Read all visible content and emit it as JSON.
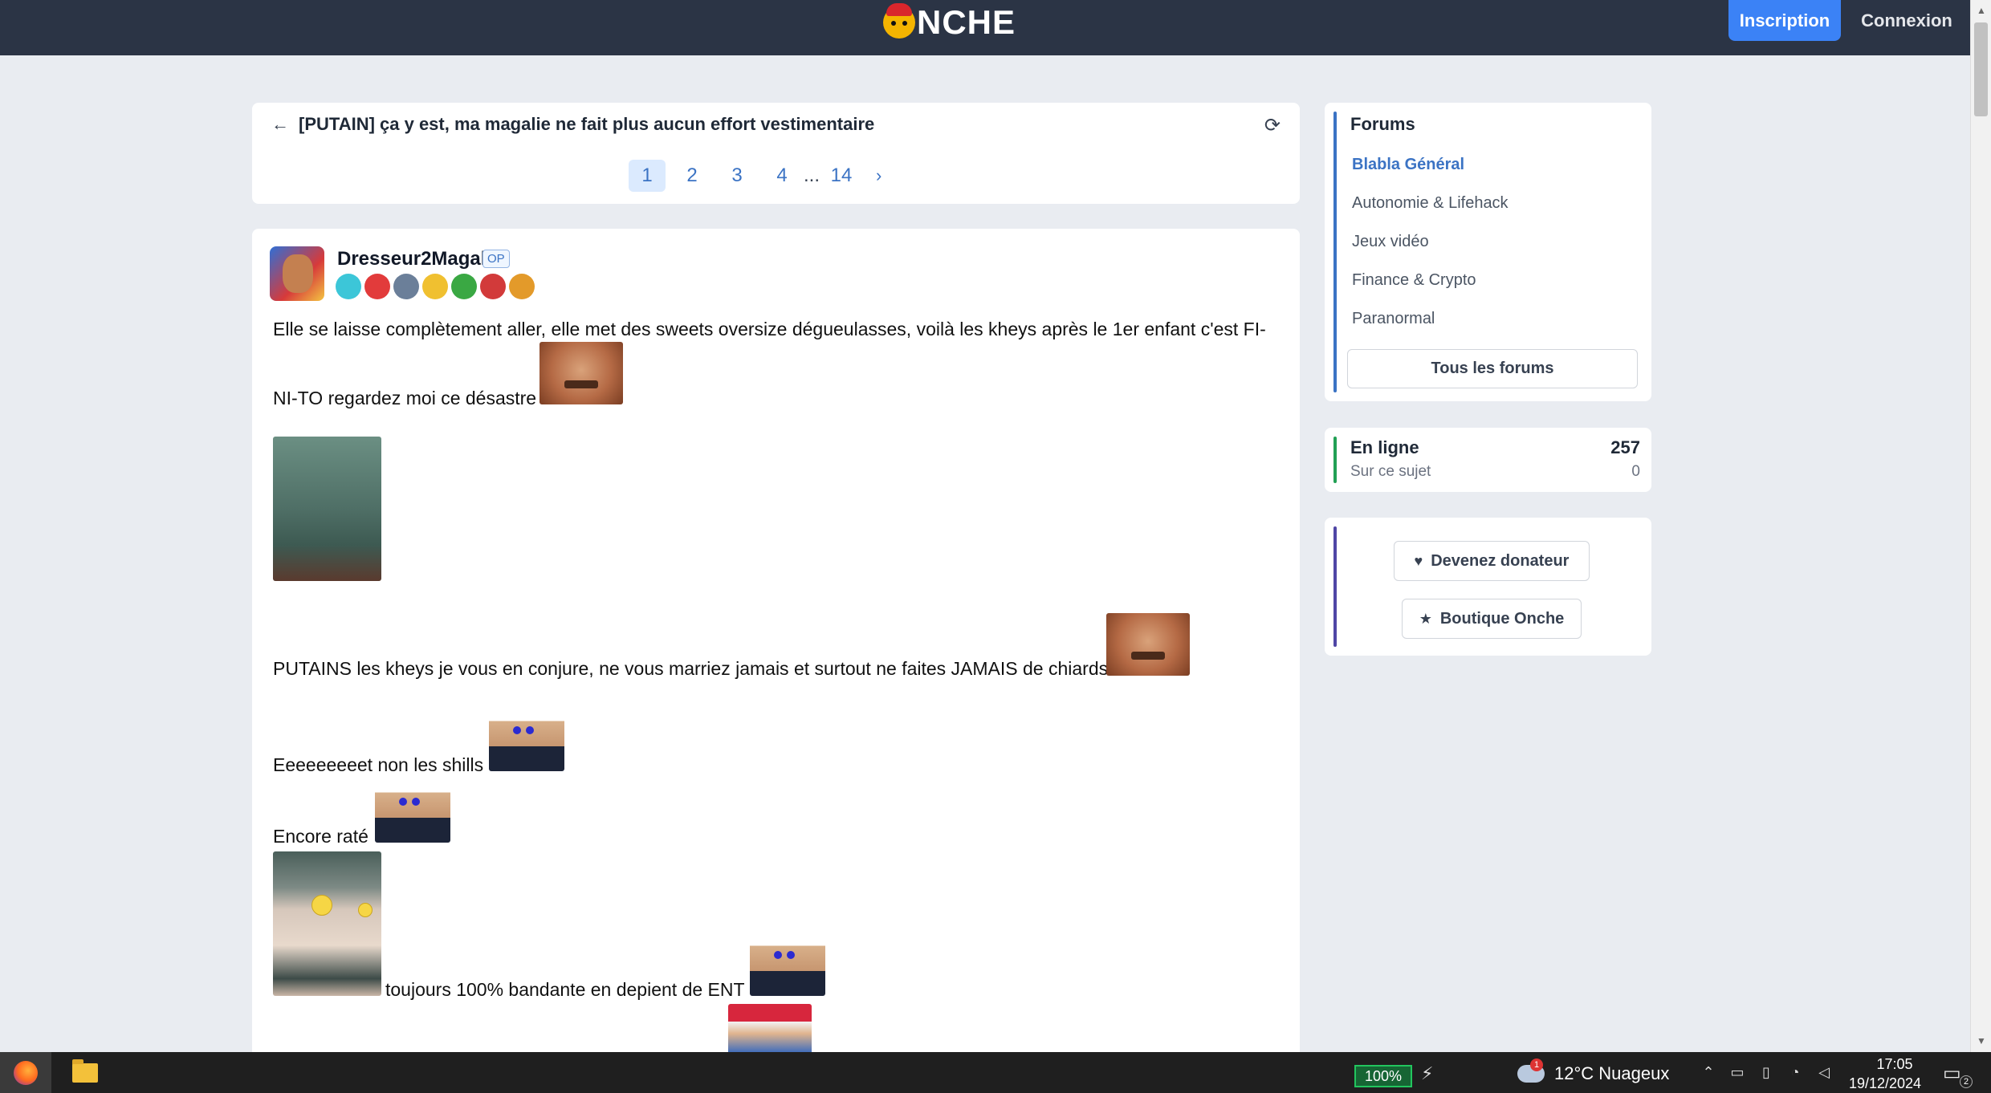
{
  "header": {
    "logo_text": "NCHE",
    "signup_label": "Inscription",
    "login_label": "Connexion",
    "background": "#2b3445",
    "accent": "#3b82f6"
  },
  "topic": {
    "back_icon": "arrow-left-icon",
    "title": "[PUTAIN] ça y est, ma magalie ne fait plus aucun effort vestimentaire",
    "refresh_icon": "refresh-icon",
    "pagination": {
      "pages": [
        "1",
        "2",
        "3",
        "4"
      ],
      "current": "1",
      "ellipsis": "...",
      "last": "14",
      "next_icon": "chevron-right-icon"
    }
  },
  "post": {
    "author": "Dresseur2Magali",
    "op_badge": "OP",
    "badge_colors": [
      "#3cc6d8",
      "#e23b3b",
      "#6b7f99",
      "#f0c030",
      "#3aa843",
      "#d23a3a",
      "#e39a2a"
    ],
    "lines": [
      "Elle se laisse complètement aller, elle met des sweets oversize dégueulasses, voilà les kheys après le 1er enfant c'est FI-",
      "NI-TO regardez moi ce désastre",
      "PUTAINS les kheys je vous en conjure, ne vous marriez jamais et surtout ne faites JAMAIS de chiards",
      "Eeeeeeeeet non les shills",
      "Encore raté",
      "toujours 100% bandante en depient de ENT"
    ]
  },
  "sidebar": {
    "forums": {
      "title": "Forums",
      "accent": "#3b73c4",
      "items": [
        {
          "label": "Blabla Général",
          "active": true
        },
        {
          "label": "Autonomie & Lifehack",
          "active": false
        },
        {
          "label": "Jeux vidéo",
          "active": false
        },
        {
          "label": "Finance & Crypto",
          "active": false
        },
        {
          "label": "Paranormal",
          "active": false
        }
      ],
      "all_label": "Tous les forums"
    },
    "online": {
      "accent": "#22a055",
      "label": "En ligne",
      "count": "257",
      "topic_label": "Sur ce sujet",
      "topic_count": "0"
    },
    "support": {
      "accent": "#4f46a5",
      "donate_label": "Devenez donateur",
      "donate_icon": "heart-icon",
      "shop_label": "Boutique Onche",
      "shop_icon": "star-icon"
    }
  },
  "taskbar": {
    "battery": "100%",
    "weather": "12°C  Nuageux",
    "weather_badge": "1",
    "time": "17:05",
    "date": "19/12/2024",
    "notifications": "2"
  }
}
